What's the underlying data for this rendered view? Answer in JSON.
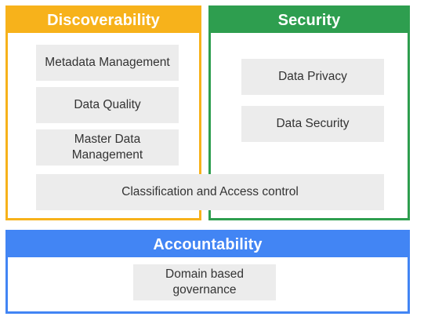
{
  "panels": {
    "discoverability": {
      "title": "Discoverability"
    },
    "security": {
      "title": "Security"
    },
    "accountability": {
      "title": "Accountability"
    }
  },
  "items": {
    "metadata_management": "Metadata Management",
    "data_quality": "Data Quality",
    "master_data_management": "Master Data Management",
    "data_privacy": "Data Privacy",
    "data_security": "Data Security",
    "classification_access": "Classification and Access control",
    "domain_governance": "Domain based governance"
  },
  "colors": {
    "discoverability": "#F7B21B",
    "security": "#2E9E4F",
    "accountability": "#4285F4",
    "item_background": "#ECECEC"
  }
}
